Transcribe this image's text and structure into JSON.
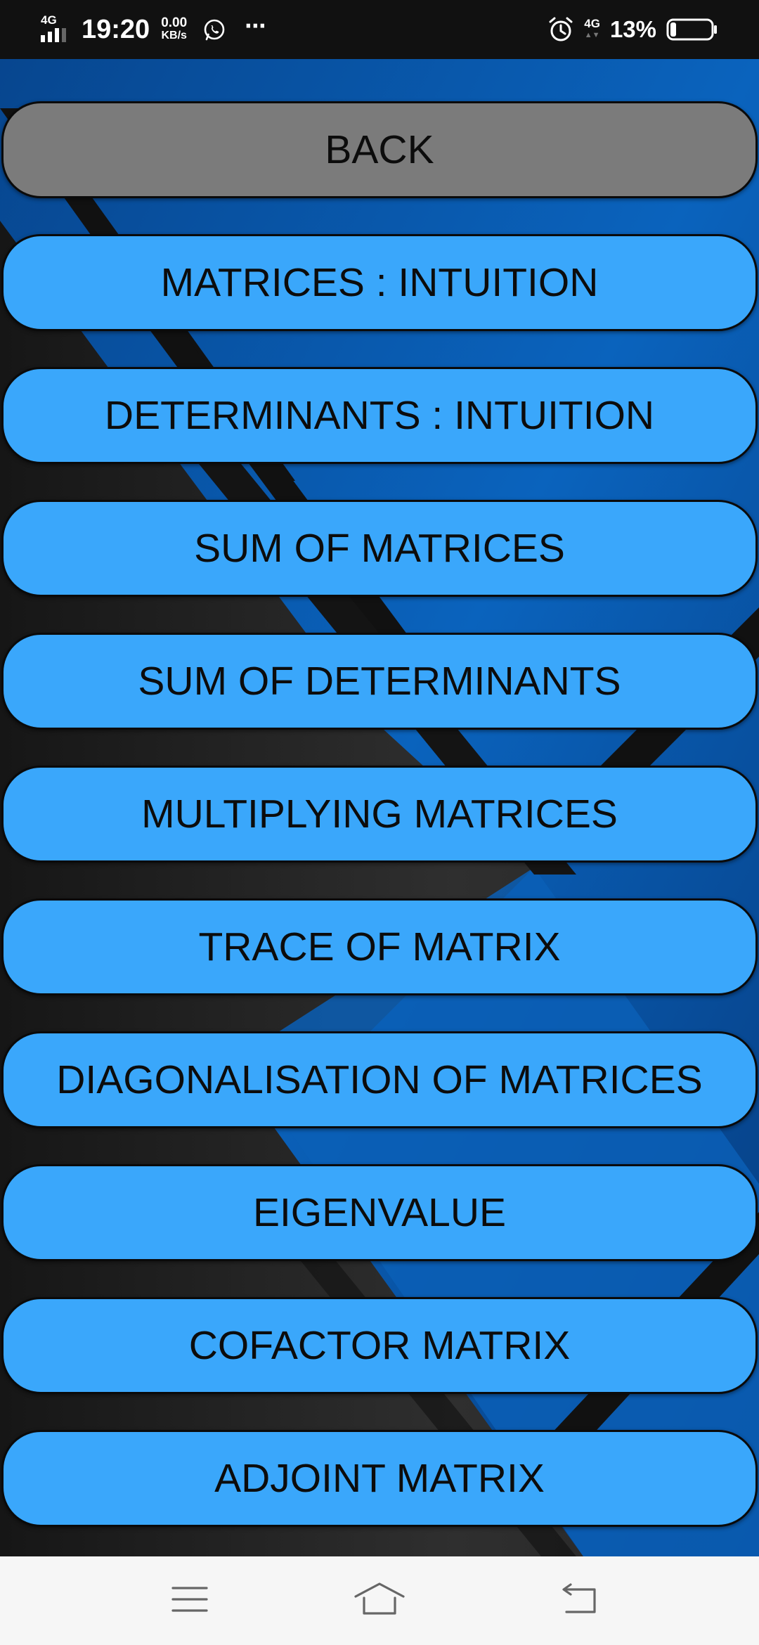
{
  "status_bar": {
    "network_left": "4G",
    "time": "19:20",
    "speed_value": "0.00",
    "speed_unit": "KB/s",
    "more": "⋯",
    "network_right": "4G",
    "battery_percent": "13%",
    "battery_level": 0.13,
    "icons": [
      "signal-icon",
      "whatsapp-icon",
      "more-icon",
      "alarm-icon",
      "battery-icon"
    ]
  },
  "menu": {
    "items": [
      {
        "label": "BACK",
        "kind": "back"
      },
      {
        "label": "MATRICES : INTUITION",
        "kind": "topic"
      },
      {
        "label": "DETERMINANTS : INTUITION",
        "kind": "topic"
      },
      {
        "label": "SUM OF MATRICES",
        "kind": "topic"
      },
      {
        "label": "SUM OF DETERMINANTS",
        "kind": "topic"
      },
      {
        "label": "MULTIPLYING MATRICES",
        "kind": "topic"
      },
      {
        "label": "TRACE OF MATRIX",
        "kind": "topic"
      },
      {
        "label": "DIAGONALISATION OF MATRICES",
        "kind": "topic"
      },
      {
        "label": "EIGENVALUE",
        "kind": "topic"
      },
      {
        "label": "COFACTOR MATRIX",
        "kind": "topic"
      },
      {
        "label": "ADJOINT MATRIX",
        "kind": "topic"
      }
    ]
  },
  "nav_bar": {
    "icons": [
      "menu-icon",
      "home-icon",
      "back-icon"
    ]
  },
  "colors": {
    "topic_button": "#3aa7fb",
    "back_button": "#7b7b7b",
    "background_blue": "#0a5fb6",
    "background_dark": "#222222",
    "status_bar": "#111111",
    "nav_bar": "#f6f6f6"
  }
}
